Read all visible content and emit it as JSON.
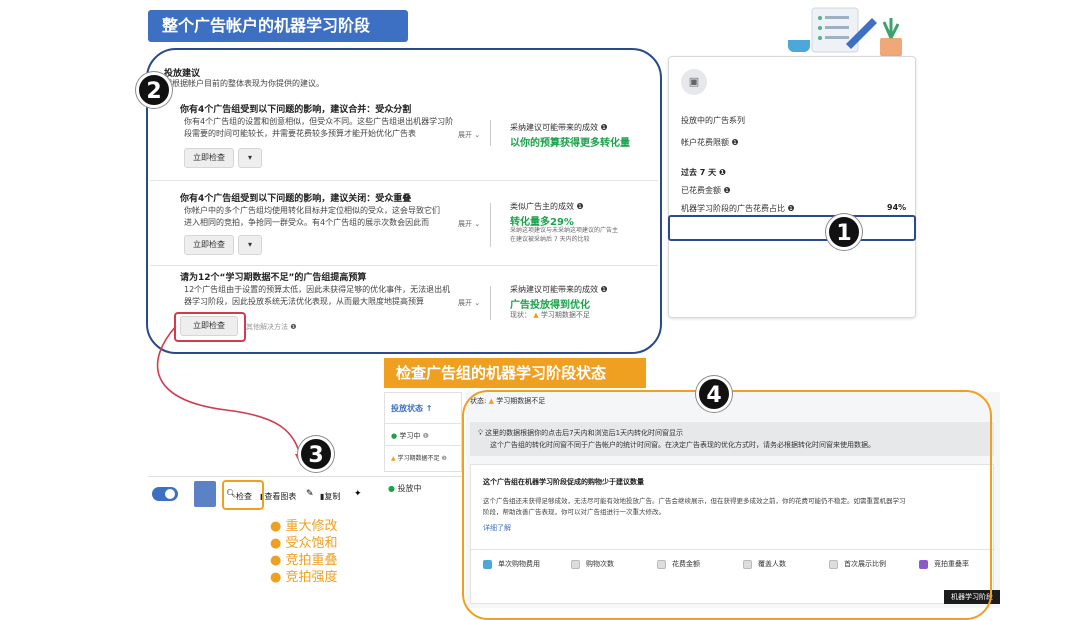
{
  "top_banner": "整个广告帐户的机器学习阶段",
  "mid_banner": "检查广告组的机器学习阶段状态",
  "badges": [
    "1",
    "2",
    "3",
    "4"
  ],
  "recommendations": {
    "title": "投放建议",
    "subtitle": "们根据帐户目前的整体表现为你提供的建议。",
    "items": [
      {
        "title": "你有4个广告组受到以下问题的影响，建议合并：受众分割",
        "desc1": "你有4个广告组的设置和创意相似，但受众不同。这些广告组退出机器学习阶",
        "desc2": "段需要的时间可能较长，并需要花费较多预算才能开始优化广告表",
        "expand": "展开",
        "button": "立即检查",
        "side_label": "采纳建议可能带来的成效",
        "side_value": "以你的预算获得更多转化量",
        "side_note1": "",
        "side_note2": ""
      },
      {
        "title": "你有4个广告组受到以下问题的影响，建议关闭：受众重叠",
        "desc1": "你帐户中的多个广告组均使用转化目标并定位相似的受众，这会导致它们",
        "desc2": "进入相同的竞拍，争抢同一群受众。有4个广告组的展示次数会因此而",
        "expand": "展开",
        "button": "立即检查",
        "side_label": "类似广告主的成效",
        "side_value": "转化量多29%",
        "side_note1": "采纳这项建议与未采纳这项建议的广告主",
        "side_note2": "在建议被采纳后 7 天内的比较"
      },
      {
        "title": "请为12个“学习期数据不足”的广告组提高预算",
        "desc1": "12个广告组由于设置的预算太低，因此未获得足够的优化事件，无法退出机",
        "desc2": "器学习阶段，因此投放系统无法优化表现，从而最大限度地提高预算",
        "expand": "展开",
        "button": "立即检查",
        "side_label": "采纳建议可能带来的成效",
        "side_value": "广告投放得到优化",
        "side_note1": "现状：",
        "side_note2": "学习期数据不足"
      }
    ],
    "other_solutions": "其他解决方法"
  },
  "account_panel": {
    "active_campaigns": "投放中的广告系列",
    "spend_limit": "帐户花费限额",
    "last7": "过去 7 天",
    "spent": "已花费金额",
    "learning_share_label": "机器学习阶段的广告花费占比",
    "learning_share_value": "94%"
  },
  "table_panel": {
    "delivery_header": "投放状态",
    "status_learning": "学习中",
    "status_limited": "学习期数据不足",
    "delivering": "投放中",
    "tooltip_status_label": "状态",
    "tooltip_status_value": "学习期数据不足"
  },
  "toolbar": {
    "check": "检查",
    "view_chart": "查看图表",
    "duplicate": "复制"
  },
  "bullets": [
    "重大修改",
    "受众饱和",
    "竞拍重叠",
    "竞拍强度"
  ],
  "detail_panel": {
    "notice1": "这里的数据根据你的点击后7天内和浏览后1天内转化时间窗显示",
    "notice2": "这个广告组的转化时间窗不同于广告帐户的统计时间窗。在决定广告表现的优化方式时，请务必根据转化时间窗来使用数据。",
    "heading": "这个广告组在机器学习阶段促成的购物少于建议数量",
    "body1": "这个广告组还未获得足够成效，无法尽可能有效地投放广告。广告会继续展示，但在获得更多成效之前，你的花费可能仍不稳定。如需重置机器学习",
    "body2": "阶段，帮助改善广告表现，你可以对广告组进行一次重大修改。",
    "learn_more": "详细了解",
    "metrics": [
      "单次购物费用",
      "购物次数",
      "花费金额",
      "覆盖人数",
      "首次展示比例",
      "竞拍重叠率"
    ],
    "corner_tag": "机器学习阶段"
  },
  "colors": {
    "banner_blue": "#3d6fc3",
    "banner_orange": "#f0a020",
    "outline_blue": "#2b4a8b",
    "outline_orange": "#f0a020",
    "highlight_red": "#d23a4d",
    "green": "#1aa34a",
    "bullet_orange": "#f0a020"
  }
}
